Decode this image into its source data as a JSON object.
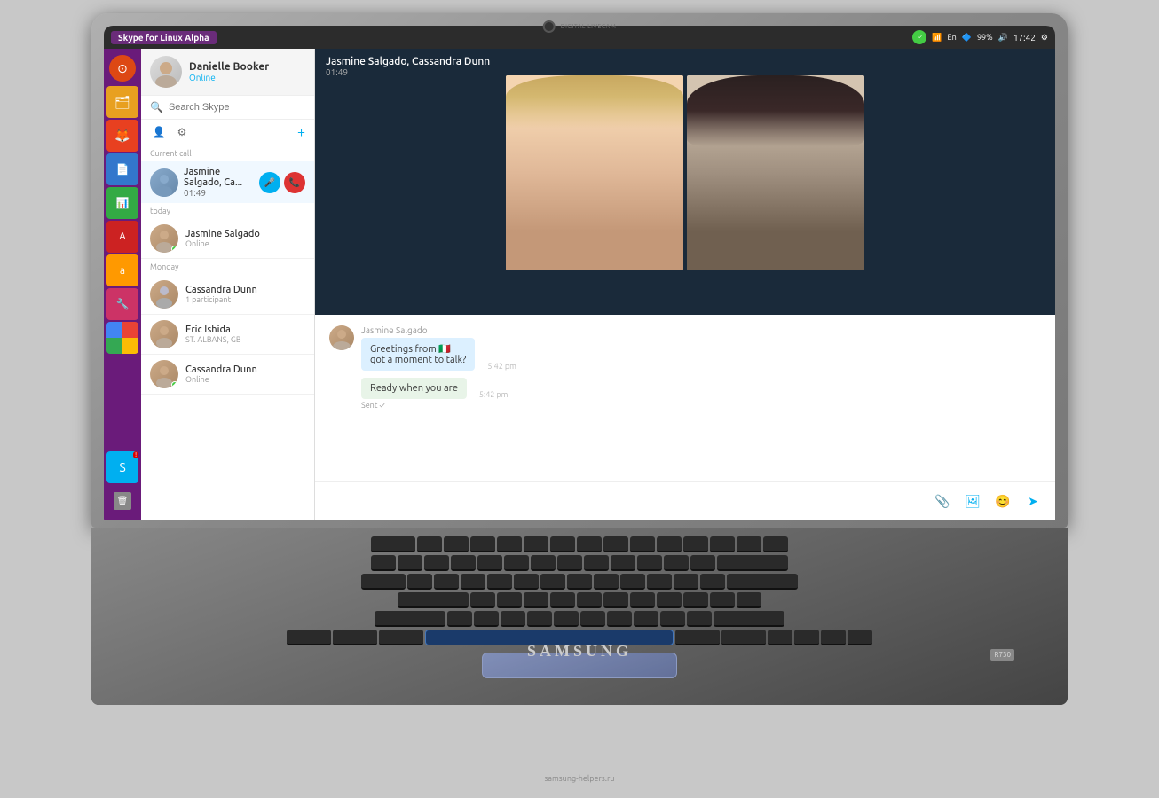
{
  "laptop": {
    "brand": "SAMSUNG",
    "model": "R730",
    "website": "samsung-helpers.ru"
  },
  "taskbar": {
    "app_title": "Skype for Linux Alpha",
    "time": "17:42",
    "battery": "99%",
    "wifi_icon": "wifi",
    "power_icon": "power"
  },
  "profile": {
    "name": "Danielle Booker",
    "status": "Online"
  },
  "search": {
    "placeholder": "Search Skype"
  },
  "current_call": {
    "section_label": "Current call",
    "participants": "Jasmine Salgado, Ca...",
    "timer": "01:49"
  },
  "contacts": {
    "today_label": "today",
    "monday_label": "Monday",
    "items": [
      {
        "name": "Jasmine Salgado",
        "sub": "Online",
        "status": "online"
      },
      {
        "name": "Cassandra Dunn",
        "sub": "1 participant",
        "status": "offline"
      },
      {
        "name": "Eric Ishida",
        "sub": "ST. ALBANS, GB",
        "status": "offline"
      },
      {
        "name": "Cassandra Dunn",
        "sub": "Online",
        "status": "online"
      }
    ]
  },
  "chat": {
    "title": "Jasmine Salgado, Cassandra Dunn",
    "timer": "01:49",
    "messages": [
      {
        "sender": "Jasmine Salgado",
        "text1": "Greetings from 🇮🇹",
        "text2": "got a moment to talk?",
        "time": "5:42 pm",
        "type": "received"
      },
      {
        "sender": "",
        "text1": "Ready when you are",
        "time": "5:42 pm",
        "status": "Sent ✓",
        "type": "sent"
      }
    ]
  },
  "input": {
    "placeholder": ""
  },
  "toolbar": {
    "add_label": "+",
    "contacts_icon": "contacts",
    "settings_icon": "settings"
  }
}
